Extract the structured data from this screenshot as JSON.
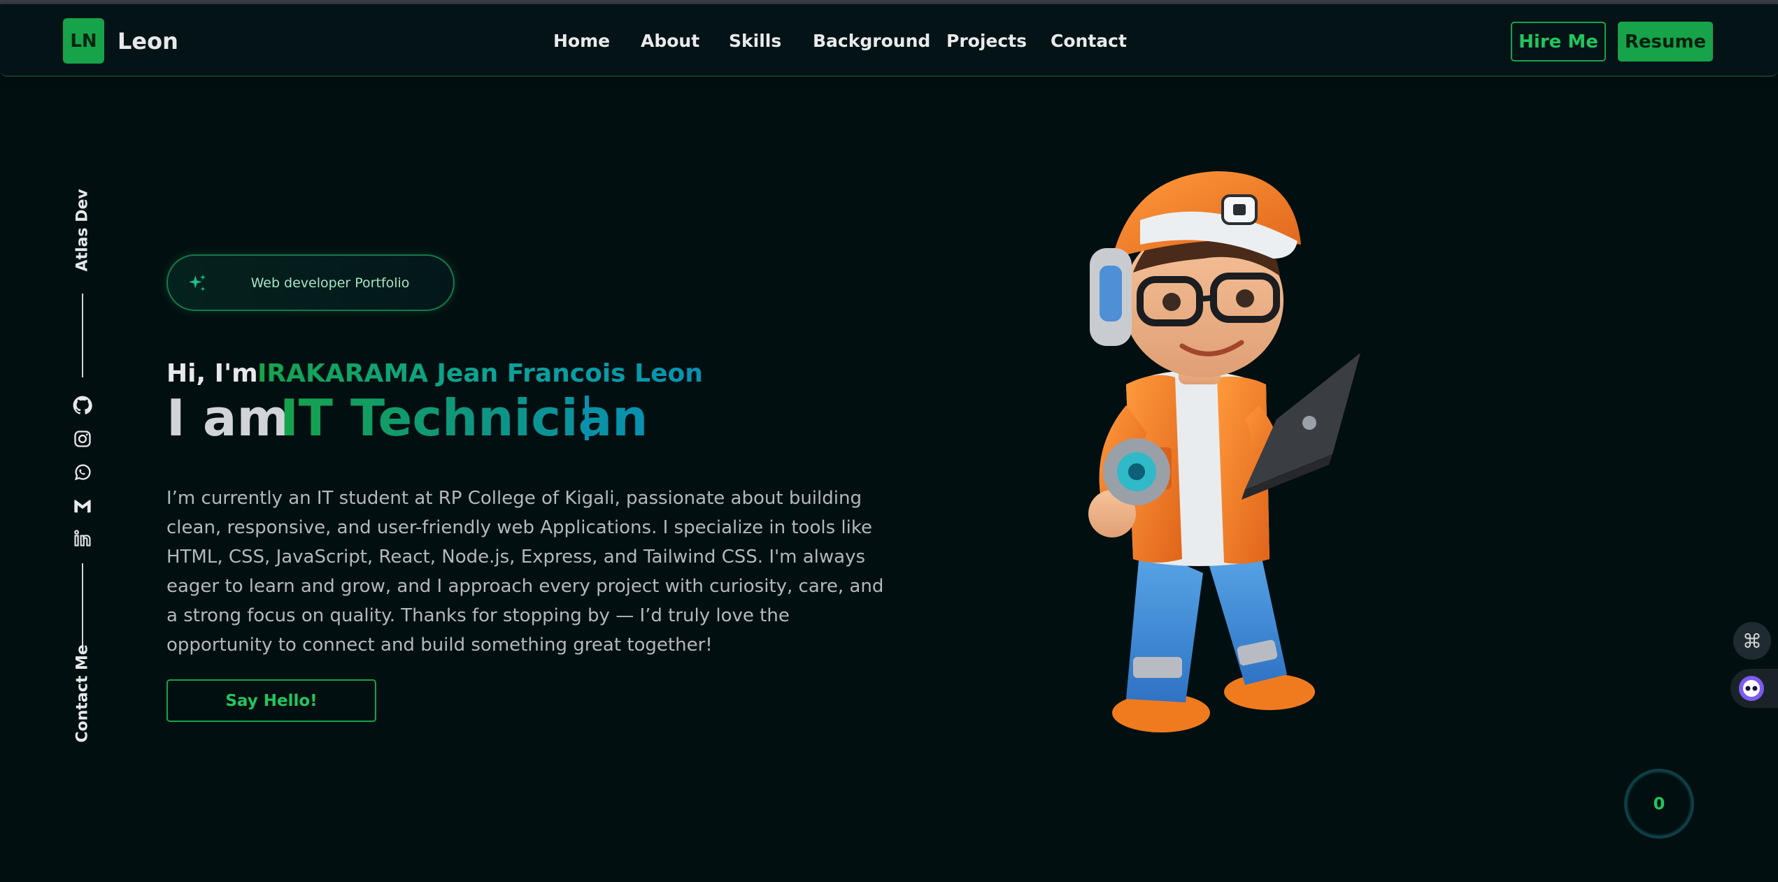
{
  "navbar": {
    "logo_initials": "LN",
    "logo_name": "Leon",
    "links": [
      "Home",
      "About",
      "Skills",
      "Background",
      "Projects",
      "Contact"
    ],
    "hire_label": "Hire Me",
    "resume_label": "Resume"
  },
  "side": {
    "top_label": "Atlas Dev",
    "bottom_label": "Contact Me",
    "socials": [
      "github-icon",
      "instagram-icon",
      "whatsapp-icon",
      "gmail-icon",
      "linkedin-icon"
    ]
  },
  "hero": {
    "badge": "Web developer Portfolio",
    "greeting": "Hi, I'm",
    "name": "IRAKARAMA Jean Francois Leon",
    "iam": "I am",
    "role": "IT Technician",
    "bio": "I’m currently an IT student at RP College of Kigali, passionate about building clean, responsive, and user-friendly web Applications. I specialize in tools like HTML, CSS, JavaScript, React, Node.js, Express, and Tailwind CSS. I'm always eager to learn and grow, and I approach every project with curiosity, care, and a strong focus on quality. Thanks for stopping by — I’d truly love the opportunity to connect and build something great together!",
    "cta": "Say Hello!"
  },
  "floating": {
    "command_icon": "command-icon",
    "bot_icon": "chatbot-icon",
    "counter": "0"
  },
  "colors": {
    "accent": "#16a34a",
    "accent_light": "#22c55e",
    "teal": "#0891b2",
    "background": "#020f11"
  }
}
